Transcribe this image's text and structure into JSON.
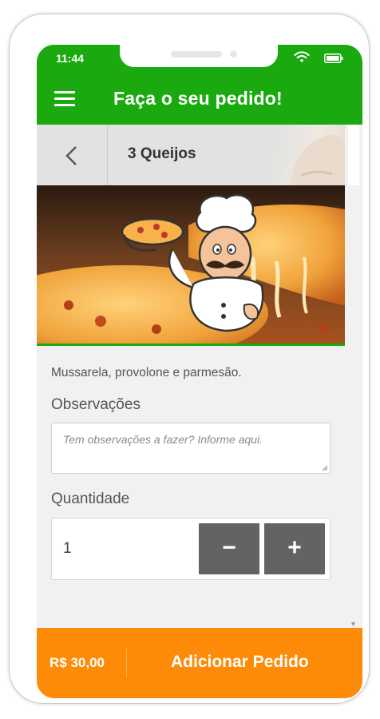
{
  "status_bar": {
    "time": "11:44"
  },
  "header": {
    "title": "Faça o seu pedido!",
    "menu_icon": "hamburger-menu-icon"
  },
  "product": {
    "name": "3 Queijos",
    "back_icon": "chevron-left-icon",
    "description": "Mussarela, provolone e parmesão."
  },
  "observations": {
    "label": "Observações",
    "placeholder": "Tem observações a fazer?  Informe aqui."
  },
  "quantity": {
    "label": "Quantidade",
    "value": "1",
    "minus_label": "−",
    "plus_label": "+"
  },
  "footer": {
    "price": "R$ 30,00",
    "add_label": "Adicionar Pedido"
  },
  "colors": {
    "primary_green": "#1aaa0f",
    "accent_orange": "#fd8b07",
    "button_gray": "#636363"
  }
}
